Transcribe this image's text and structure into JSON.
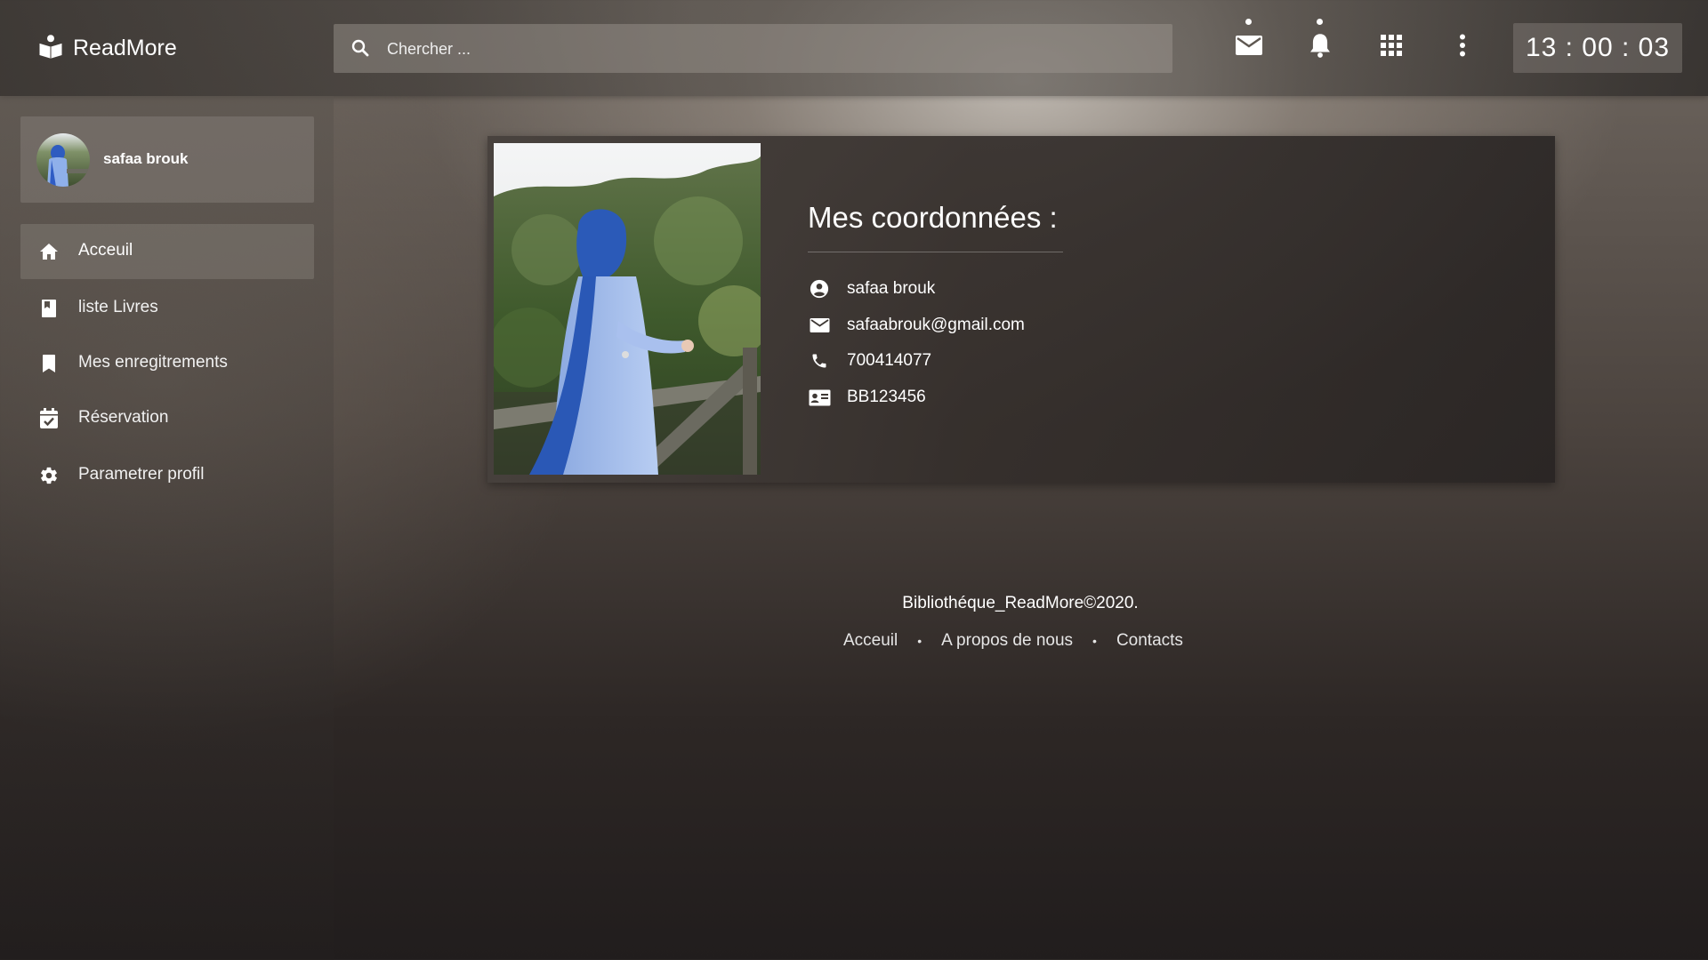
{
  "app": {
    "brand": "ReadMore"
  },
  "header": {
    "search_placeholder": "Chercher ...",
    "clock": "13 : 00 : 03",
    "icons": [
      "mail-icon",
      "bell-icon",
      "apps-grid-icon",
      "more-vertical-icon"
    ]
  },
  "sidebar": {
    "user_name": "safaa brouk",
    "items": [
      {
        "label": "Acceuil",
        "icon": "home-icon",
        "active": true
      },
      {
        "label": "liste Livres",
        "icon": "book-icon",
        "active": false
      },
      {
        "label": "Mes enregitrements",
        "icon": "bookmark-icon",
        "active": false
      },
      {
        "label": "Réservation",
        "icon": "calendar-check-icon",
        "active": false
      },
      {
        "label": "Parametrer profil",
        "icon": "gear-icon",
        "active": false
      }
    ]
  },
  "main": {
    "title": "Mes coordonnées :",
    "info": [
      {
        "icon": "account-circle-icon",
        "value": "safaa brouk"
      },
      {
        "icon": "mail-icon",
        "value": "safaabrouk@gmail.com"
      },
      {
        "icon": "phone-icon",
        "value": "700414077"
      },
      {
        "icon": "id-card-icon",
        "value": "BB123456"
      }
    ]
  },
  "footer": {
    "copyright": "Bibliothéque_ReadMore©2020.",
    "links": [
      "Acceuil",
      "A propos de nous",
      "Contacts"
    ]
  },
  "colors": {
    "text": "#ffffff",
    "panel": "#8c8680",
    "card": "#463f3b"
  }
}
